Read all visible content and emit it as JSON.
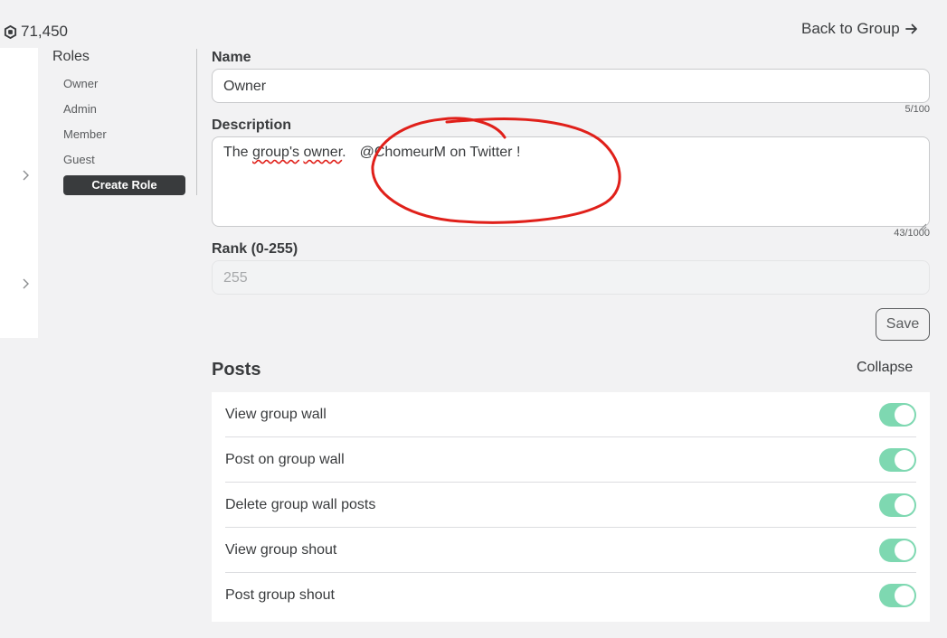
{
  "header": {
    "robux_amount": "71,450",
    "robux_icon": "robux-icon",
    "back_link": "Back to Group"
  },
  "roles": {
    "title": "Roles",
    "items": [
      "Owner",
      "Admin",
      "Member",
      "Guest"
    ],
    "create_button": "Create Role"
  },
  "form": {
    "name_label": "Name",
    "name_value": "Owner",
    "name_counter": "5/100",
    "description_label": "Description",
    "description_parts": {
      "word1": "The ",
      "word2": "group's",
      "word3": " ",
      "word4": "owner",
      "word5": ".",
      "annotation_text": "@ChomeurM on Twitter !"
    },
    "description_counter": "43/1000",
    "rank_label": "Rank (0-255)",
    "rank_value": "255",
    "save_button": "Save"
  },
  "posts": {
    "title": "Posts",
    "collapse_label": "Collapse",
    "permissions": [
      {
        "label": "View group wall",
        "enabled": true
      },
      {
        "label": "Post on group wall",
        "enabled": true
      },
      {
        "label": "Delete group wall posts",
        "enabled": true
      },
      {
        "label": "View group shout",
        "enabled": true
      },
      {
        "label": "Post group shout",
        "enabled": true
      }
    ]
  },
  "colors": {
    "toggle_on": "#7ed8b1",
    "annotation": "#e0201a",
    "primary_dark": "#393b3d"
  }
}
